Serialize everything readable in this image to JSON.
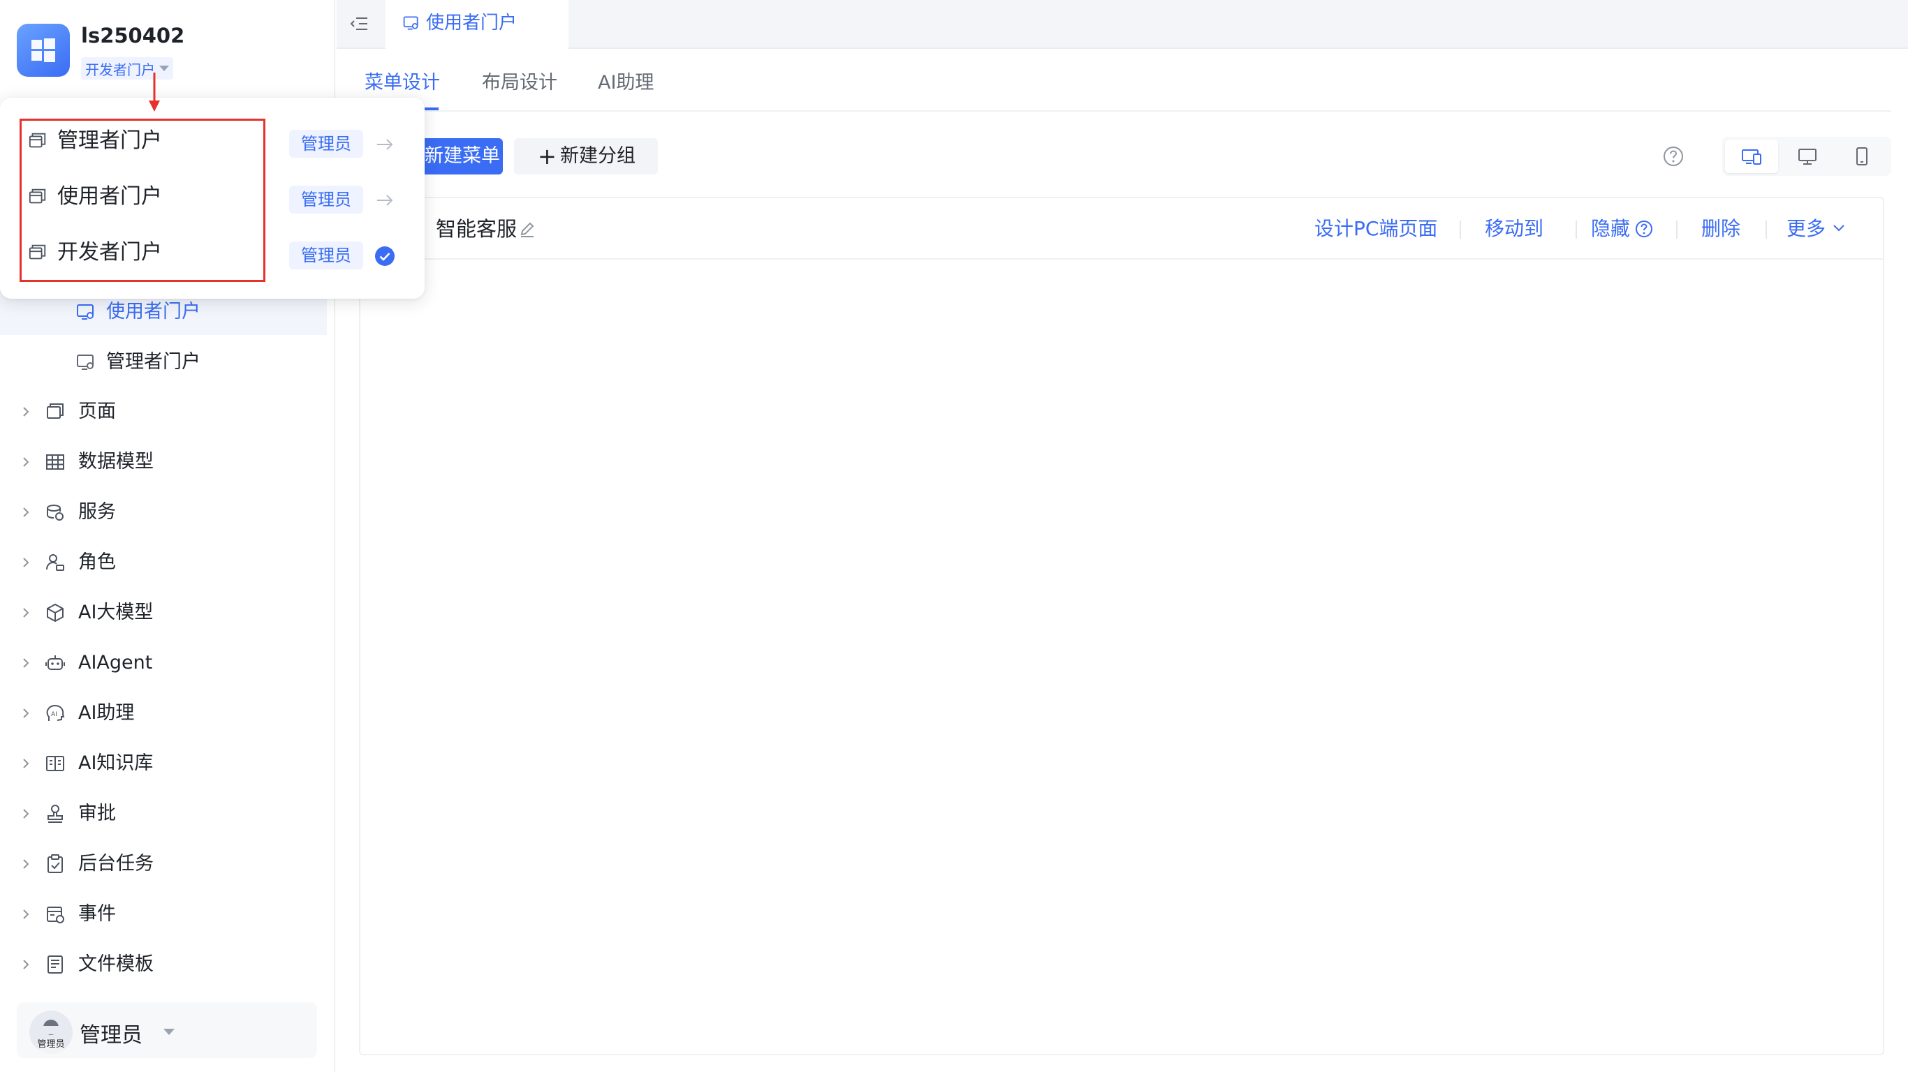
{
  "app": {
    "name": "ls250402",
    "current_portal": "开发者门户"
  },
  "sidebar": {
    "portal_children": [
      {
        "label": "使用者门户",
        "active": true
      },
      {
        "label": "管理者门户",
        "active": false
      }
    ],
    "items": [
      {
        "label": "页面",
        "icon": "page-icon"
      },
      {
        "label": "数据模型",
        "icon": "table-icon"
      },
      {
        "label": "服务",
        "icon": "database-icon"
      },
      {
        "label": "角色",
        "icon": "role-icon"
      },
      {
        "label": "AI大模型",
        "icon": "cube-icon"
      },
      {
        "label": "AIAgent",
        "icon": "robot-icon"
      },
      {
        "label": "AI助理",
        "icon": "ai-assistant-icon"
      },
      {
        "label": "AI知识库",
        "icon": "book-icon"
      },
      {
        "label": "审批",
        "icon": "stamp-icon"
      },
      {
        "label": "后台任务",
        "icon": "clipboard-icon"
      },
      {
        "label": "事件",
        "icon": "event-icon"
      },
      {
        "label": "文件模板",
        "icon": "file-template-icon"
      }
    ],
    "user": {
      "name": "管理员",
      "avatar_tag": "管理员"
    }
  },
  "topbar": {
    "open_tab": "使用者门户"
  },
  "subtabs": [
    {
      "label": "菜单设计",
      "active": true
    },
    {
      "label": "布局设计",
      "active": false
    },
    {
      "label": "AI助理",
      "active": false
    }
  ],
  "toolbar": {
    "new_menu_label": "新建菜单",
    "new_group_label": "新建分组",
    "new_group_icon": "+"
  },
  "card": {
    "title": "智能客服",
    "actions": {
      "design_pc": "设计PC端页面",
      "move_to": "移动到",
      "hide": "隐藏",
      "delete": "删除",
      "more": "更多"
    }
  },
  "dropdown": {
    "options": [
      {
        "label": "管理者门户",
        "role": "管理员",
        "selected": false
      },
      {
        "label": "使用者门户",
        "role": "管理员",
        "selected": false
      },
      {
        "label": "开发者门户",
        "role": "管理员",
        "selected": true
      }
    ]
  },
  "colors": {
    "accent": "#3a6cf4",
    "highlight": "#e5322d"
  }
}
